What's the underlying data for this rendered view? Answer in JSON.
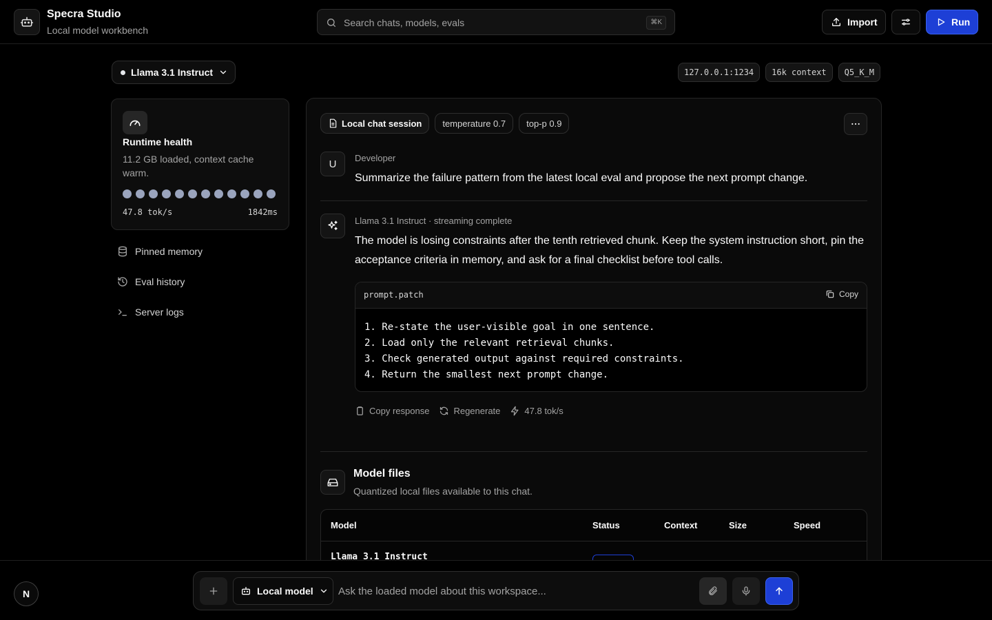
{
  "app": {
    "title": "Specra Studio",
    "subtitle": "Local model workbench"
  },
  "search": {
    "placeholder": "Search chats, models, evals",
    "shortcut": "⌘K"
  },
  "toolbar": {
    "import_label": "Import",
    "run_label": "Run"
  },
  "model_bar": {
    "selected_model": "Llama 3.1 Instruct",
    "chips": [
      "127.0.0.1:1234",
      "16k context",
      "Q5_K_M"
    ]
  },
  "runtime": {
    "title": "Runtime health",
    "description": "11.2 GB loaded, context cache warm.",
    "bar_segments": 12,
    "throughput": "47.8 tok/s",
    "latency": "1842ms"
  },
  "sidebar": {
    "items": [
      {
        "label": "Pinned memory",
        "icon": "database-icon"
      },
      {
        "label": "Eval history",
        "icon": "history-icon"
      },
      {
        "label": "Server logs",
        "icon": "terminal-icon"
      }
    ]
  },
  "session": {
    "title": "Local chat session",
    "params": [
      "temperature 0.7",
      "top-p 0.9"
    ]
  },
  "messages": {
    "user": {
      "avatar": "U",
      "author": "Developer",
      "text": "Summarize the failure pattern from the latest local eval and propose the next prompt change."
    },
    "assistant": {
      "meta": "Llama 3.1 Instruct · streaming complete",
      "text": "The model is losing constraints after the tenth retrieved chunk. Keep the system instruction short, pin the acceptance criteria in memory, and ask for a final checklist before tool calls.",
      "code": {
        "filename": "prompt.patch",
        "copy_label": "Copy",
        "lines": [
          "1. Re-state the user-visible goal in one sentence.",
          "2. Load only the relevant retrieval chunks.",
          "3. Check generated output against required constraints.",
          "4. Return the smallest next prompt change."
        ]
      },
      "actions": {
        "copy": "Copy response",
        "regenerate": "Regenerate",
        "speed": "47.8 tok/s"
      }
    }
  },
  "model_files": {
    "title": "Model files",
    "subtitle": "Quantized local files available to this chat.",
    "columns": [
      "Model",
      "Status",
      "Context",
      "Size",
      "Speed"
    ],
    "rows": [
      {
        "model": "Llama 3.1 Instruct"
      }
    ]
  },
  "composer": {
    "user_initial": "N",
    "model_label": "Local model",
    "placeholder": "Ask the loaded model about this workspace..."
  },
  "colors": {
    "accent": "#1d3fd6",
    "background": "#000000",
    "dots": "#9aa4bd"
  }
}
